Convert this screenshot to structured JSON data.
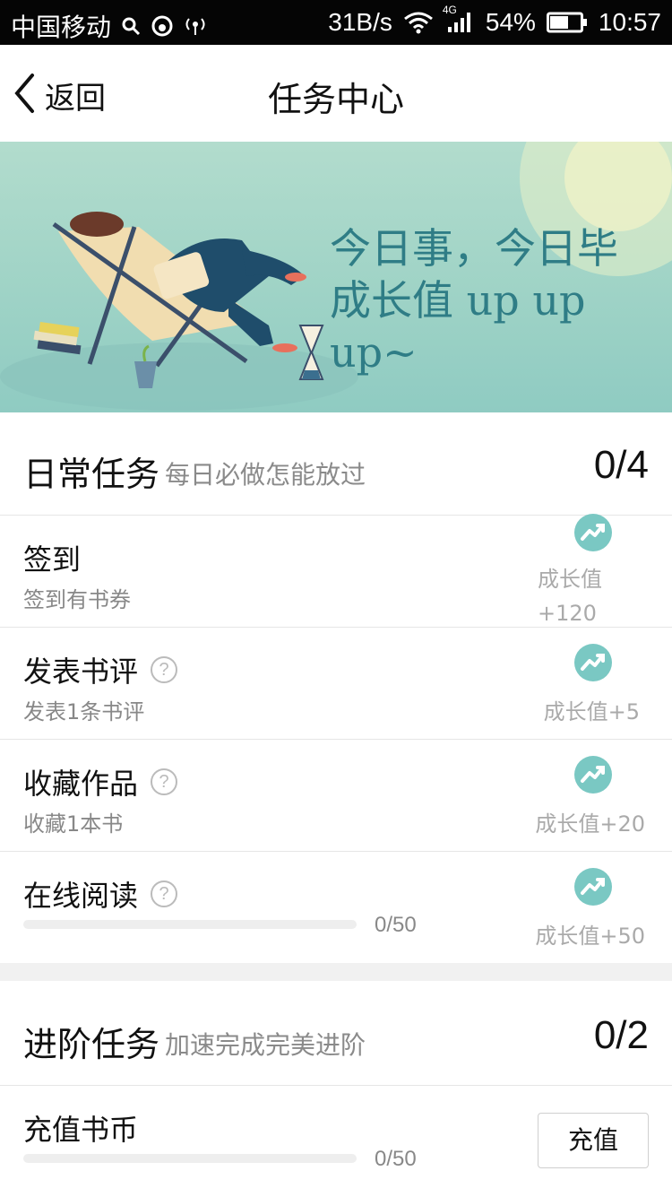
{
  "status_bar": {
    "carrier": "中国移动",
    "speed": "31B/s",
    "network": "4G",
    "battery": "54%",
    "time": "10:57"
  },
  "nav": {
    "back_label": "返回",
    "title": "任务中心"
  },
  "banner": {
    "line1": "今日事，今日毕",
    "line2": "成长值 up up up~"
  },
  "daily": {
    "title": "日常任务",
    "subtitle": "每日必做怎能放过",
    "count": "0/4",
    "tasks": [
      {
        "title": "签到",
        "desc": "签到有书券",
        "reward_line1": "成长值",
        "reward_line2": "+120"
      },
      {
        "title": "发表书评",
        "desc": "发表1条书评",
        "reward": "成长值+5"
      },
      {
        "title": "收藏作品",
        "desc": "收藏1本书",
        "reward": "成长值+20"
      },
      {
        "title": "在线阅读",
        "progress_text": "0/50",
        "progress": 0,
        "reward": "成长值+50"
      }
    ]
  },
  "advanced": {
    "title": "进阶任务",
    "subtitle": "加速完成完美进阶",
    "count": "0/2",
    "tasks": [
      {
        "title": "充值书币",
        "progress_text": "0/50",
        "progress": 0,
        "button": "充值"
      }
    ]
  },
  "colors": {
    "accent": "#7ac8c3",
    "banner_text": "#2f7d86"
  }
}
